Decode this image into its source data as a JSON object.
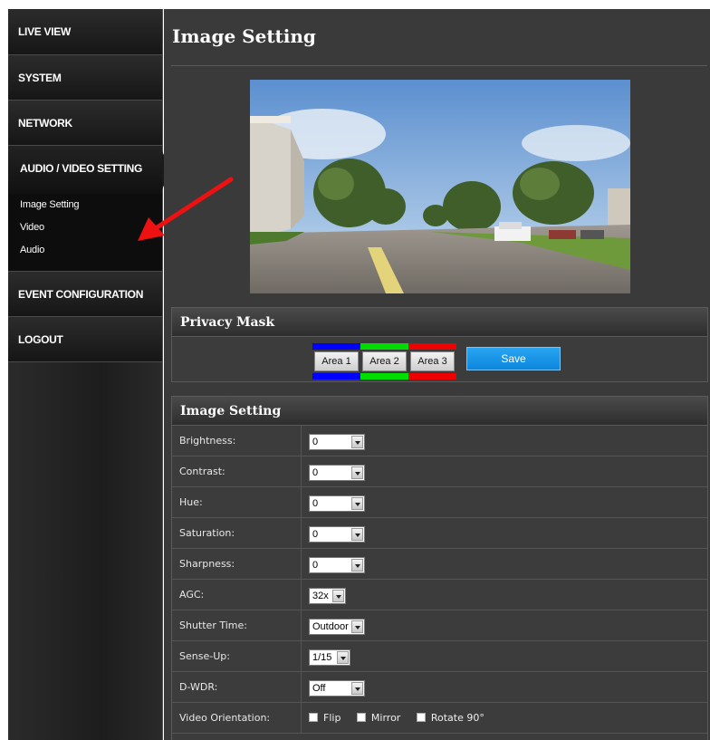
{
  "sidebar": {
    "items": [
      {
        "label": "LIVE VIEW"
      },
      {
        "label": "SYSTEM"
      },
      {
        "label": "NETWORK"
      },
      {
        "label": "AUDIO / VIDEO SETTING"
      },
      {
        "label": "EVENT CONFIGURATION"
      },
      {
        "label": "LOGOUT"
      }
    ],
    "sub_items": [
      {
        "label": "Image Setting"
      },
      {
        "label": "Video"
      },
      {
        "label": "Audio"
      }
    ]
  },
  "main": {
    "title": "Image Setting"
  },
  "privacy_mask": {
    "heading": "Privacy Mask",
    "areas": [
      {
        "label": "Area 1",
        "color": "#0000ff"
      },
      {
        "label": "Area 2",
        "color": "#00dd00"
      },
      {
        "label": "Area 3",
        "color": "#ee0000"
      }
    ],
    "save_label": "Save"
  },
  "image_setting": {
    "heading": "Image Setting",
    "rows": [
      {
        "label": "Brightness:",
        "value": "0"
      },
      {
        "label": "Contrast:",
        "value": "0"
      },
      {
        "label": "Hue:",
        "value": "0"
      },
      {
        "label": "Saturation:",
        "value": "0"
      },
      {
        "label": "Sharpness:",
        "value": "0"
      },
      {
        "label": "AGC:",
        "value": "32x"
      },
      {
        "label": "Shutter Time:",
        "value": "Outdoor"
      },
      {
        "label": "Sense-Up:",
        "value": "1/15"
      },
      {
        "label": "D-WDR:",
        "value": "Off"
      }
    ],
    "orientation": {
      "label": "Video Orientation:",
      "options": [
        {
          "label": "Flip"
        },
        {
          "label": "Mirror"
        },
        {
          "label": "Rotate 90°"
        }
      ]
    }
  },
  "colors": {
    "accent_blue": "#0b86dc",
    "annotation_arrow": "#ee1111"
  }
}
